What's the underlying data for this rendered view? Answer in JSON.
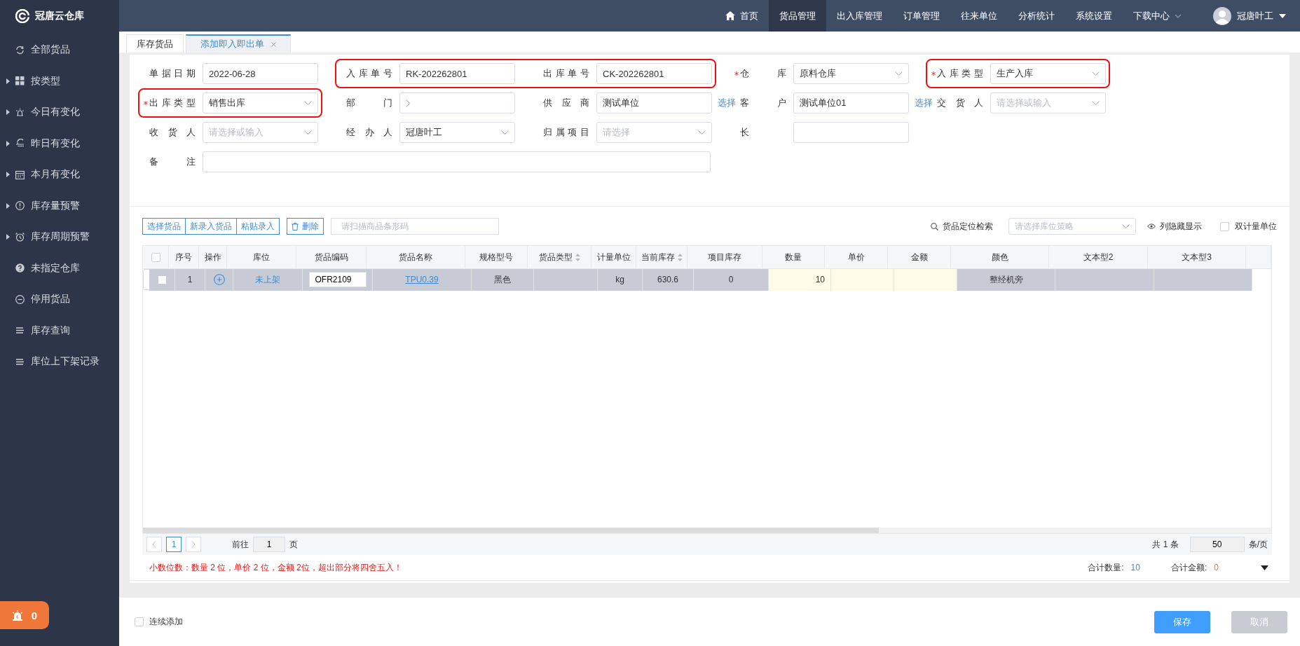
{
  "app": {
    "name": "冠唐云仓库"
  },
  "nav": [
    {
      "label": "首页",
      "selected": false,
      "kind": "home"
    },
    {
      "label": "货品管理",
      "selected": true,
      "kind": "plain"
    },
    {
      "label": "出入库管理",
      "selected": false,
      "kind": "plain"
    },
    {
      "label": "订单管理",
      "selected": false,
      "kind": "plain"
    },
    {
      "label": "往来单位",
      "selected": false,
      "kind": "plain"
    },
    {
      "label": "分析统计",
      "selected": false,
      "kind": "plain"
    },
    {
      "label": "系统设置",
      "selected": false,
      "kind": "plain"
    },
    {
      "label": "下载中心",
      "selected": false,
      "kind": "dropdown"
    }
  ],
  "user": {
    "name": "冠唐叶工"
  },
  "sidebar": {
    "items": [
      {
        "label": "全部货品",
        "has_children": false
      },
      {
        "label": "按类型",
        "has_children": true
      },
      {
        "label": "今日有变化",
        "has_children": true
      },
      {
        "label": "昨日有变化",
        "has_children": true
      },
      {
        "label": "本月有变化",
        "has_children": true
      },
      {
        "label": "库存量预警",
        "has_children": true
      },
      {
        "label": "库存周期预警",
        "has_children": true
      },
      {
        "label": "未指定仓库",
        "has_children": false
      },
      {
        "label": "停用货品",
        "has_children": false
      },
      {
        "label": "库存查询",
        "has_children": false
      },
      {
        "label": "库位上下架记录",
        "has_children": false
      }
    ],
    "alarm_count": "0"
  },
  "tabs": [
    {
      "label": "库存货品",
      "selected": false,
      "closable": false
    },
    {
      "label": "添加即入即出单",
      "selected": true,
      "closable": true
    }
  ],
  "form": {
    "rows": [
      [
        {
          "kind": "input",
          "label": "单据日期",
          "required": false,
          "highlighted": false,
          "value": "2022-06-28"
        },
        {
          "kind": "input",
          "label": "入库单号",
          "required": false,
          "highlighted": true,
          "value": "RK-202262801"
        },
        {
          "kind": "input",
          "label": "出库单号",
          "required": false,
          "highlighted": true,
          "value": "CK-202262801"
        },
        {
          "kind": "select",
          "label": "仓库",
          "required": true,
          "highlighted": false,
          "value": "原料仓库"
        },
        {
          "kind": "select",
          "label": "入库类型",
          "required": true,
          "highlighted": true,
          "value": "生产入库"
        }
      ],
      [
        {
          "kind": "select",
          "label": "出库类型",
          "required": true,
          "highlighted": true,
          "value": "销售出库"
        },
        {
          "kind": "cascader",
          "label": "部门",
          "required": false,
          "highlighted": false
        },
        {
          "kind": "input",
          "label": "供应商",
          "required": false,
          "highlighted": false,
          "value": "测试单位",
          "link": "选择"
        },
        {
          "kind": "input",
          "label": "客户",
          "required": false,
          "highlighted": false,
          "value": "测试单位01",
          "link": "选择"
        },
        {
          "kind": "select",
          "label": "交货人",
          "required": false,
          "highlighted": false,
          "placeholder": "请选择或输入"
        }
      ],
      [
        {
          "kind": "select",
          "label": "收货人",
          "required": false,
          "highlighted": false,
          "placeholder": "请选择或输入"
        },
        {
          "kind": "select",
          "label": "经办人",
          "required": false,
          "highlighted": false,
          "value": "冠唐叶工"
        },
        {
          "kind": "select",
          "label": "归属项目",
          "required": false,
          "highlighted": false,
          "placeholder": "请选择"
        },
        {
          "kind": "input",
          "label": "长",
          "required": false,
          "highlighted": false
        }
      ],
      [
        {
          "kind": "wide",
          "label": "备注",
          "required": false
        }
      ]
    ]
  },
  "toolbar": {
    "buttons": [
      "选择货品",
      "新录入货品",
      "粘贴录入"
    ],
    "delete": "删除",
    "scan_placeholder": "请扫描商品条形码",
    "locate": "货品定位检索",
    "strategy_placeholder": "请选择库位策略",
    "columns_toggle": "列隐藏显示",
    "dual_unit": {
      "label": "双计量单位",
      "checked": false
    }
  },
  "table": {
    "all_checked": false,
    "columns": [
      {
        "title": "序号",
        "kind": "text",
        "sortable": false
      },
      {
        "title": "操作",
        "kind": "action",
        "sortable": false
      },
      {
        "title": "库位",
        "kind": "location",
        "sortable": false
      },
      {
        "title": "货品编码",
        "kind": "input",
        "sortable": false
      },
      {
        "title": "货品名称",
        "kind": "link",
        "sortable": false
      },
      {
        "title": "规格型号",
        "kind": "text",
        "sortable": false
      },
      {
        "title": "货品类型",
        "kind": "text",
        "sortable": true
      },
      {
        "title": "计量单位",
        "kind": "text",
        "sortable": false
      },
      {
        "title": "当前库存",
        "kind": "text",
        "sortable": true
      },
      {
        "title": "项目库存",
        "kind": "text",
        "sortable": false
      },
      {
        "title": "数量",
        "kind": "editable",
        "sortable": false
      },
      {
        "title": "单价",
        "kind": "editable",
        "sortable": false
      },
      {
        "title": "金额",
        "kind": "editable",
        "sortable": false
      },
      {
        "title": "颜色",
        "kind": "text",
        "sortable": false
      },
      {
        "title": "文本型2",
        "kind": "text",
        "sortable": false
      },
      {
        "title": "文本型3",
        "kind": "text",
        "sortable": false
      }
    ],
    "rows": [
      {
        "checked": false,
        "selected": true,
        "cells": [
          "1",
          "",
          "未上架",
          "OFR2109",
          "TPU0.39",
          "黑色",
          "",
          "kg",
          "630.6",
          "0",
          "10",
          "",
          "",
          "整经机旁",
          "",
          ""
        ]
      }
    ]
  },
  "pagination": {
    "pages": [
      {
        "label": "1",
        "selected": true
      }
    ],
    "goto_label": "前往",
    "goto_value": "1",
    "page_unit": "页",
    "total": "共 1 条",
    "page_size": "50",
    "size_unit": "条/页"
  },
  "summary": {
    "note": "小数位数：数量 2 位，单价 2 位，金额 2位，超出部分将四舍五入！",
    "qty_label": "合计数量:",
    "qty": "10",
    "amount_label": "合计金额:",
    "amount": "0"
  },
  "footer": {
    "continue": {
      "label": "连续添加",
      "checked": false
    },
    "save": "保存",
    "cancel": "取消"
  }
}
